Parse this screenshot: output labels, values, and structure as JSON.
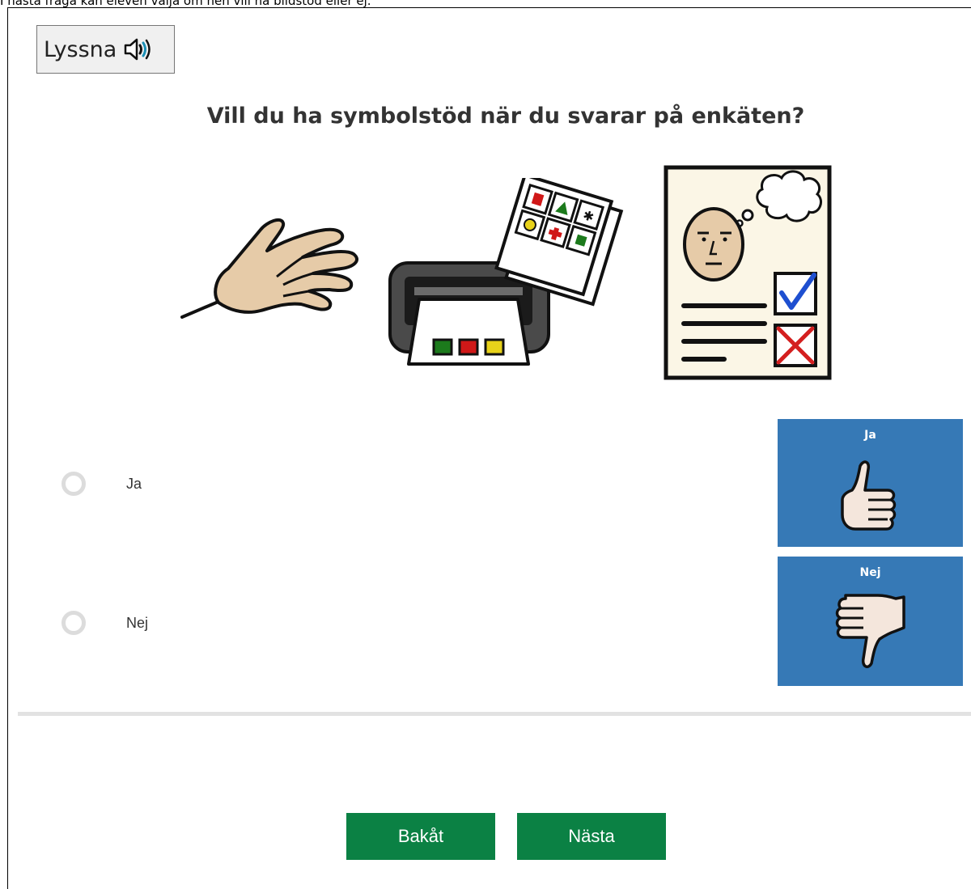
{
  "caption": "I nästa fråga kan eleven välja om hen vill ha bildstöd eller ej.",
  "listen_button": {
    "label": "Lyssna",
    "icon": "speaker-icon"
  },
  "question": "Vill du ha symbolstöd när du svarar på enkäten?",
  "illustration_icons": [
    "hand-icon",
    "printer-icon",
    "survey-paper-icon"
  ],
  "options": [
    {
      "label": "Ja",
      "symbol_title": "Ja",
      "symbol_icon": "thumbs-up-icon",
      "selected": false
    },
    {
      "label": "Nej",
      "symbol_title": "Nej",
      "symbol_icon": "thumbs-down-icon",
      "selected": false
    }
  ],
  "nav": {
    "back_label": "Bakåt",
    "next_label": "Nästa"
  },
  "colors": {
    "symbol_bg": "#3679b6",
    "nav_button": "#0b8144",
    "radio_border": "#dcdcdc",
    "divider": "#e2e2e2"
  }
}
